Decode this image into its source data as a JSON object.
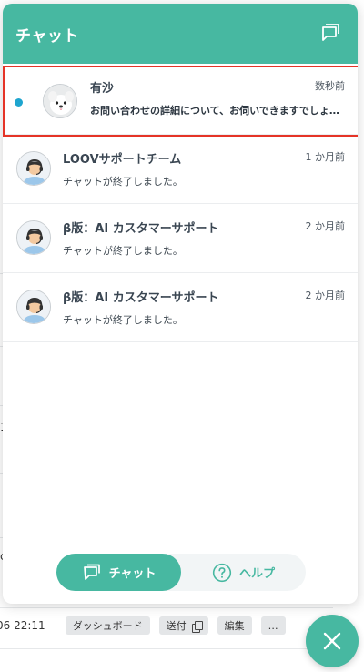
{
  "background": {
    "fragments": [
      "1",
      "c"
    ],
    "row": {
      "date": "06 22:11",
      "buttons": [
        "ダッシュボード",
        "送付",
        "編集",
        "…"
      ]
    }
  },
  "widget": {
    "title": "チャット",
    "conversations": [
      {
        "name": "有沙",
        "time": "数秒前",
        "preview": "お問い合わせの詳細について、お伺いできますでしょうか？",
        "unread": true,
        "avatar": "dog-avatar"
      },
      {
        "name": "LOOVサポートチーム",
        "time": "1 か月前",
        "preview": "チャットが終了しました。",
        "unread": false,
        "avatar": "operator-avatar"
      },
      {
        "name": "β版：AI カスタマーサポート",
        "time": "2 か月前",
        "preview": "チャットが終了しました。",
        "unread": false,
        "avatar": "operator-avatar"
      },
      {
        "name": "β版：AI カスタマーサポート",
        "time": "2 か月前",
        "preview": "チャットが終了しました。",
        "unread": false,
        "avatar": "operator-avatar"
      }
    ],
    "tabs": {
      "chat_label": "チャット",
      "help_label": "ヘルプ",
      "active": "chat"
    }
  },
  "colors": {
    "brand": "#47b8a1",
    "unread_dot": "#1ea5cf",
    "selection_outline": "#e53427"
  }
}
